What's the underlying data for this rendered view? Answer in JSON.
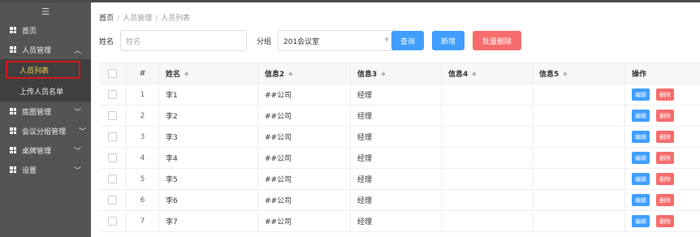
{
  "sidebar": {
    "toggle_icon": "menu-toggle-icon",
    "items": [
      {
        "label": "首页",
        "icon": "grid-icon"
      },
      {
        "label": "人员管理",
        "icon": "grid-icon",
        "expanded": true
      },
      {
        "label": "底图管理",
        "icon": "grid-icon"
      },
      {
        "label": "会议分组管理",
        "icon": "grid-icon"
      },
      {
        "label": "桌牌管理",
        "icon": "grid-icon"
      },
      {
        "label": "设置",
        "icon": "grid-icon"
      }
    ],
    "subitems": [
      {
        "label": "人员列表",
        "active": true
      },
      {
        "label": "上传人员名单",
        "active": false
      }
    ],
    "chevron_up": "︿",
    "chevron_down": "﹀"
  },
  "breadcrumb": {
    "home": "首页",
    "sep": "/",
    "section": "人员管理",
    "current": "人员列表"
  },
  "filter": {
    "name_label": "姓名",
    "name_placeholder": "姓名",
    "group_label": "分组",
    "group_value": "201会议室",
    "query_label": "查询",
    "add_label": "新增",
    "batch_delete_label": "批量删除"
  },
  "table": {
    "headers": [
      "#",
      "姓名",
      "信息2",
      "信息3",
      "信息4",
      "信息5",
      "操作"
    ],
    "edit_label": "编辑",
    "delete_label": "删除",
    "rows": [
      {
        "no": "1",
        "name": "李1",
        "info2": "##公司",
        "info3": "经理",
        "info4": "",
        "info5": ""
      },
      {
        "no": "2",
        "name": "李2",
        "info2": "##公司",
        "info3": "经理",
        "info4": "",
        "info5": ""
      },
      {
        "no": "3",
        "name": "李3",
        "info2": "##公司",
        "info3": "经理",
        "info4": "",
        "info5": ""
      },
      {
        "no": "4",
        "name": "李4",
        "info2": "##公司",
        "info3": "经理",
        "info4": "",
        "info5": ""
      },
      {
        "no": "5",
        "name": "李5",
        "info2": "##公司",
        "info3": "经理",
        "info4": "",
        "info5": ""
      },
      {
        "no": "6",
        "name": "李6",
        "info2": "##公司",
        "info3": "经理",
        "info4": "",
        "info5": ""
      },
      {
        "no": "7",
        "name": "李7",
        "info2": "##公司",
        "info3": "经理",
        "info4": "",
        "info5": ""
      }
    ]
  },
  "colors": {
    "sidebar_bg": "#545454",
    "active_text": "#f4d24a",
    "highlight_border": "#d9161b",
    "primary": "#409eff",
    "danger": "#f56c6c"
  }
}
